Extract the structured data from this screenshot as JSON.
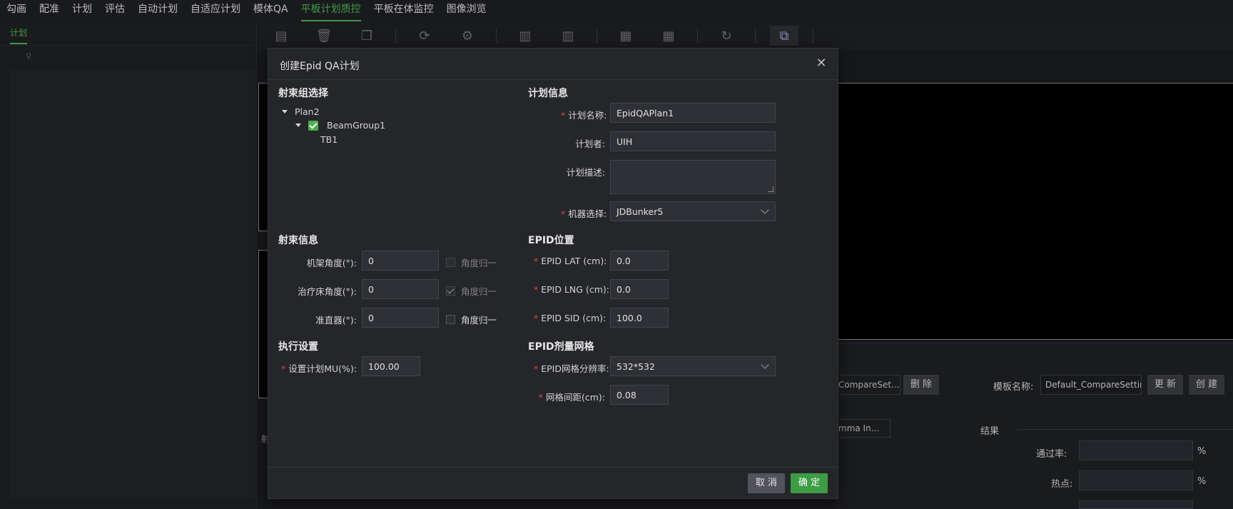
{
  "nav": {
    "items": [
      "勾画",
      "配准",
      "计划",
      "评估",
      "自动计划",
      "自适应计划",
      "模体QA",
      "平板计划质控",
      "平板在体监控",
      "图像浏览"
    ],
    "active_index": 7
  },
  "left_panel": {
    "tab": "计划"
  },
  "background": {
    "compare_select": "CompareSet...",
    "delete_btn": "删 除",
    "template_label": "模板名称:",
    "template_value": "Default_CompareSetting",
    "update_btn": "更 新",
    "create_btn": "创 建",
    "gamma_select": "mma In...",
    "result_title": "结果",
    "pass_rate_label": "通过率:",
    "hotspot_label": "热点:",
    "percent": "%",
    "left_bottom_text": "射"
  },
  "modal": {
    "title": "创建Epid QA计划",
    "beam_group_section": "射束组选择",
    "tree": {
      "plan": "Plan2",
      "beam_group": "BeamGroup1",
      "beam": "TB1"
    },
    "plan_info_section": "计划信息",
    "plan_name_label": "计划名称:",
    "plan_name_value": "EpidQAPlan1",
    "planner_label": "计划者:",
    "planner_value": "UIH",
    "plan_desc_label": "计划描述:",
    "plan_desc_value": "",
    "machine_label": "机器选择:",
    "machine_value": "JDBunker5",
    "beam_info_section": "射束信息",
    "gantry_label": "机架角度(°):",
    "gantry_value": "0",
    "couch_label": "治疗床角度(°):",
    "couch_value": "0",
    "collimator_label": "准直器(°):",
    "collimator_value": "0",
    "normalize_label": "角度归一",
    "epid_pos_section": "EPID位置",
    "epid_lat_label": "EPID LAT (cm):",
    "epid_lat_value": "0.0",
    "epid_lng_label": "EPID LNG (cm):",
    "epid_lng_value": "0.0",
    "epid_sid_label": "EPID SID (cm):",
    "epid_sid_value": "100.0",
    "exec_section": "执行设置",
    "mu_label": "设置计划MU(%):",
    "mu_value": "100.00",
    "grid_section": "EPID剂量网格",
    "grid_res_label": "EPID网格分辨率:",
    "grid_res_value": "532*532",
    "grid_spacing_label": "网格间距(cm):",
    "grid_spacing_value": "0.08",
    "cancel_btn": "取 消",
    "ok_btn": "确 定"
  },
  "colors": {
    "accent_green": "#4caf50",
    "ok_button": "#3d9c45",
    "required_star": "#e0463c"
  }
}
